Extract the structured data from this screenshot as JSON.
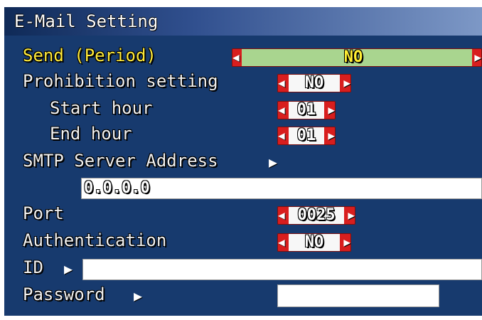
{
  "title": "E-Mail Setting",
  "rows": {
    "send_period": {
      "label": "Send (Period)",
      "value": "NO",
      "left_arrow": "◀",
      "right_arrow": "▶"
    },
    "prohibition": {
      "label": "Prohibition setting",
      "value": "NO",
      "left_arrow": "◀",
      "right_arrow": "▶"
    },
    "start_hour": {
      "label": "Start hour",
      "value": "01",
      "left_arrow": "◀",
      "right_arrow": "▶"
    },
    "end_hour": {
      "label": "End hour",
      "value": "01",
      "left_arrow": "◀",
      "right_arrow": "▶"
    },
    "smtp": {
      "label": "SMTP Server Address",
      "arrow": "▶",
      "value": "0.0.0.0"
    },
    "port": {
      "label": "Port",
      "value": "0025",
      "left_arrow": "◀",
      "right_arrow": "▶"
    },
    "authentication": {
      "label": "Authentication",
      "value": "NO",
      "left_arrow": "◀",
      "right_arrow": "▶"
    },
    "id": {
      "label": "ID",
      "arrow": "▶",
      "value": ""
    },
    "password": {
      "label": "Password",
      "arrow": "▶",
      "value": ""
    }
  },
  "colors": {
    "background": "#173a6e",
    "highlight_text": "#ffea3a",
    "selector_red": "#d81e1e",
    "selector_active": "#a9d58f",
    "field": "#ffffff"
  },
  "icons": {
    "spinner_left": "left-arrow-icon",
    "spinner_right": "right-arrow-icon",
    "submenu": "play-arrow-icon"
  }
}
